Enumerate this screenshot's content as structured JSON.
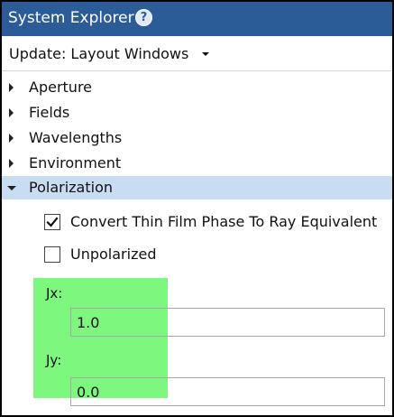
{
  "titlebar": {
    "title": "System Explorer",
    "help_icon": "?"
  },
  "update": {
    "label": "Update: Layout Windows",
    "caret_icon": "caret-down-icon"
  },
  "tree": {
    "items": [
      {
        "label": "Aperture",
        "expanded": false
      },
      {
        "label": "Fields",
        "expanded": false
      },
      {
        "label": "Wavelengths",
        "expanded": false
      },
      {
        "label": "Environment",
        "expanded": false
      },
      {
        "label": "Polarization",
        "expanded": true,
        "selected": true
      }
    ]
  },
  "polarization": {
    "convert_thin_film": {
      "label": "Convert Thin Film Phase To Ray Equivalent",
      "checked": true
    },
    "unpolarized": {
      "label": "Unpolarized",
      "checked": false
    },
    "jx": {
      "label": "Jx:",
      "value": "1.0"
    },
    "jy": {
      "label": "Jy:",
      "value": "0.0"
    }
  },
  "colors": {
    "titlebar": "#2c5c98",
    "selected_row": "#c8dcf2",
    "highlight": "#7ef77e"
  }
}
